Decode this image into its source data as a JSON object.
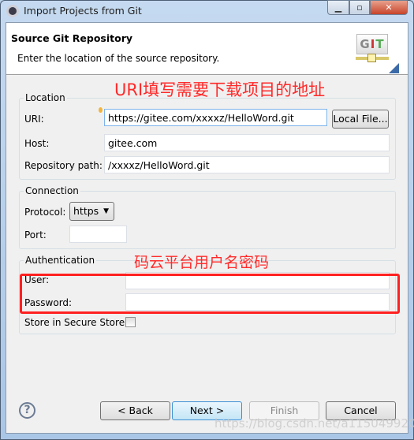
{
  "window": {
    "title": "Import Projects from Git",
    "minimize_label": "▁",
    "maximize_label": "▫",
    "close_label": "✕"
  },
  "header": {
    "title": "Source Git Repository",
    "description": "Enter the location of the source repository.",
    "logo_text": "GIT"
  },
  "annotations": {
    "uri_note": "URI填写需要下载项目的地址",
    "auth_note": "码云平台用户名密码",
    "accent_color": "#ff2020"
  },
  "location": {
    "legend": "Location",
    "uri_label": "URI:",
    "uri_value": "https://gitee.com/xxxxz/HelloWord.git",
    "local_file_button": "Local File...",
    "host_label": "Host:",
    "host_value": "gitee.com",
    "repo_path_label": "Repository path:",
    "repo_path_value": "/xxxxz/HelloWord.git"
  },
  "connection": {
    "legend": "Connection",
    "protocol_label": "Protocol:",
    "protocol_value": "https",
    "port_label": "Port:",
    "port_value": ""
  },
  "authentication": {
    "legend": "Authentication",
    "user_label": "User:",
    "user_value": "",
    "password_label": "Password:",
    "password_value": "",
    "store_label": "Store in Secure Store",
    "store_checked": false
  },
  "buttons": {
    "back": "< Back",
    "next": "Next >",
    "finish": "Finish",
    "cancel": "Cancel",
    "help": "?"
  },
  "watermark": "https://blog.csdn.net/a1150499208"
}
